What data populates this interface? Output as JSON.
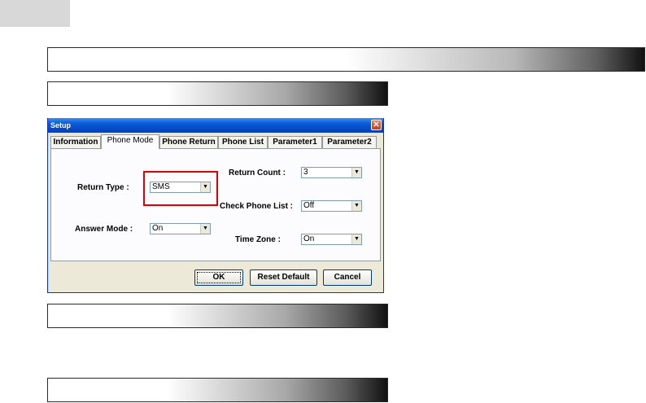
{
  "dialog": {
    "title": "Setup",
    "close_glyph": "✕",
    "tabs": [
      {
        "label": "Information"
      },
      {
        "label": "Phone Mode"
      },
      {
        "label": "Phone Return"
      },
      {
        "label": "Phone List"
      },
      {
        "label": "Parameter1"
      },
      {
        "label": "Parameter2"
      }
    ],
    "active_tab": "Phone Mode",
    "fields": {
      "return_type": {
        "label": "Return Type :",
        "value": "SMS"
      },
      "answer_mode": {
        "label": "Answer Mode :",
        "value": "On"
      },
      "return_count": {
        "label": "Return Count :",
        "value": "3"
      },
      "check_phone_list": {
        "label": "Check Phone List :",
        "value": "Off"
      },
      "time_zone": {
        "label": "Time Zone :",
        "value": "On"
      }
    },
    "buttons": {
      "ok": "OK",
      "reset": "Reset Default",
      "cancel": "Cancel"
    },
    "dropdown_arrow": "▼"
  },
  "colors": {
    "highlight": "#e00000",
    "titlebar": "#0a5fd8"
  }
}
